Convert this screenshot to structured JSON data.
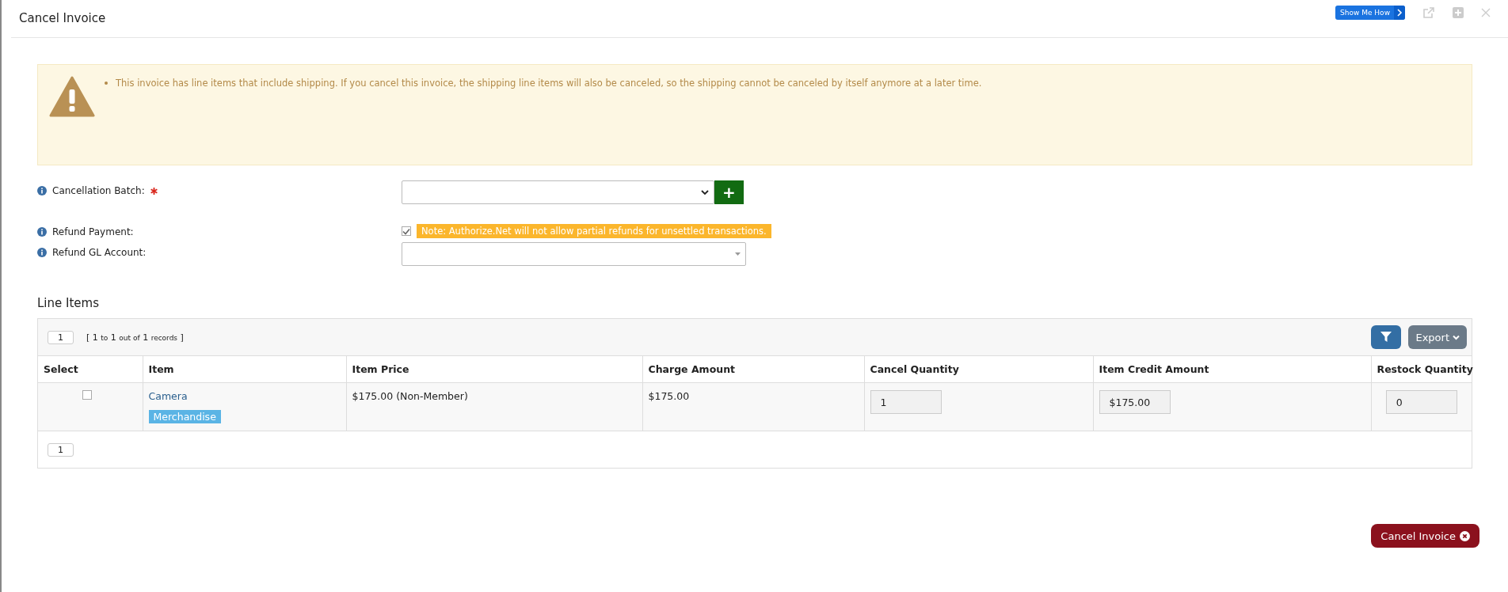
{
  "window": {
    "title": "Cancel Invoice",
    "show_me_how": "Show Me How"
  },
  "warning": {
    "messages": [
      "This invoice has line items that include shipping. If you cancel this invoice, the shipping line items will also be canceled, so the shipping cannot be canceled by itself anymore at a later time."
    ]
  },
  "fields": [
    {
      "kind": "batch",
      "label": "Cancellation Batch:",
      "required": true,
      "plus": "+"
    },
    {
      "kind": "checkbox",
      "label": "Refund Payment:",
      "required": false,
      "checked": true,
      "note": "Note: Authorize.Net will not allow partial refunds for unsettled transactions."
    },
    {
      "kind": "combo",
      "label": "Refund GL Account:",
      "required": false
    }
  ],
  "line_items": {
    "heading": "Line Items",
    "page": "1",
    "range": {
      "open": "[",
      "close": "]",
      "from": "1",
      "to": "to",
      "of_word": "1",
      "total_word": "out of",
      "count": "1",
      "records": "records"
    },
    "export": "Export",
    "columns": [
      "Select",
      "Item",
      "Item Price",
      "Charge Amount",
      "Cancel Quantity",
      "Item Credit Amount",
      "Restock Quantity"
    ],
    "rows": [
      {
        "selected": false,
        "item": "Camera",
        "tag": "Merchandise",
        "price": "$175.00 (Non-Member)",
        "charge": "$175.00",
        "cancel_qty": "1",
        "credit": "$175.00",
        "restock_qty": "0"
      }
    ],
    "footer_page": "1"
  },
  "cancel_button": "Cancel Invoice"
}
